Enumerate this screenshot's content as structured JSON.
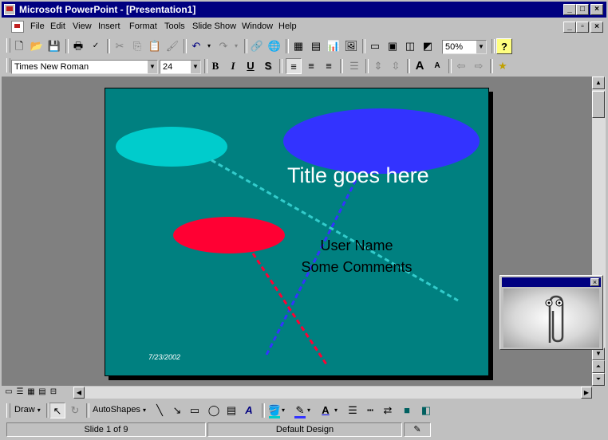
{
  "window": {
    "title": "Microsoft PowerPoint - [Presentation1]",
    "controls": [
      "_",
      "□",
      "×"
    ],
    "doc_controls": [
      "_",
      "▫",
      "×"
    ]
  },
  "menu": [
    "File",
    "Edit",
    "View",
    "Insert",
    "Format",
    "Tools",
    "Slide Show",
    "Window",
    "Help"
  ],
  "standard_toolbar": {
    "zoom": "50%"
  },
  "formatting_toolbar": {
    "font": "Times New Roman",
    "size": "24",
    "bold": "B",
    "italic": "I",
    "underline": "U",
    "shadow": "S"
  },
  "slide": {
    "title": "Title goes here",
    "user_name": "User Name",
    "comments": "Some Comments",
    "date": "7/23/2002",
    "colors": {
      "background": "#008080",
      "ellipse_cyan": "#00cccc",
      "ellipse_blue": "#3333ff",
      "ellipse_red": "#ff0033"
    }
  },
  "drawing_toolbar": {
    "draw": "Draw",
    "autoshapes": "AutoShapes"
  },
  "status": {
    "slide": "Slide 1 of 9",
    "design": "Default Design"
  }
}
